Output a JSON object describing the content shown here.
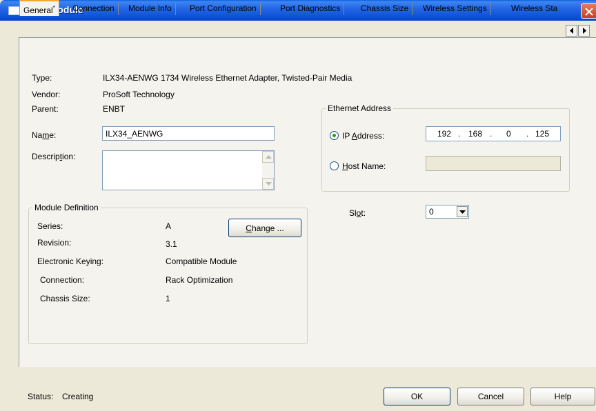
{
  "window": {
    "title": "New Module"
  },
  "tabs": [
    {
      "label": "General",
      "active": true,
      "mark": "*"
    },
    {
      "label": "Connection"
    },
    {
      "label": "Module Info"
    },
    {
      "label": "Port Configuration"
    },
    {
      "label": "Port Diagnostics"
    },
    {
      "label": "Chassis Size"
    },
    {
      "label": "Wireless Settings"
    },
    {
      "label": "Wireless Sta"
    }
  ],
  "general": {
    "type_label": "Type:",
    "type_value": "ILX34-AENWG 1734 Wireless Ethernet Adapter, Twisted-Pair Media",
    "vendor_label": "Vendor:",
    "vendor_value": "ProSoft Technology",
    "parent_label": "Parent:",
    "parent_value": "ENBT",
    "name_label_pre": "Na",
    "name_label_u": "m",
    "name_label_post": "e:",
    "name_value": "ILX34_AENWG",
    "desc_label_pre": "Descrip",
    "desc_label_u": "t",
    "desc_label_post": "ion:",
    "desc_value": ""
  },
  "module_definition": {
    "legend": "Module Definition",
    "series_label": "Series:",
    "series_value": "A",
    "revision_label": "Revision:",
    "revision_value": "3.1",
    "keying_label": "Electronic Keying:",
    "keying_value": "Compatible Module",
    "connection_label": "Connection:",
    "connection_value": "Rack Optimization",
    "chassis_label": "Chassis Size:",
    "chassis_value": "1",
    "change_pre": "",
    "change_u": "C",
    "change_post": "hange ..."
  },
  "ethernet": {
    "legend": "Ethernet Address",
    "ip_label_pre": "IP ",
    "ip_label_u": "A",
    "ip_label_post": "ddress:",
    "ip_octets": [
      "192",
      "168",
      "0",
      "125"
    ],
    "ip_dot": ".",
    "host_label_pre": "",
    "host_label_u": "H",
    "host_label_post": "ost Name:",
    "host_value": "",
    "selected": "ip"
  },
  "slot": {
    "label_pre": "Sl",
    "label_u": "o",
    "label_post": "t:",
    "value": "0"
  },
  "footer": {
    "status_label": "Status:",
    "status_value": "Creating",
    "ok": "OK",
    "cancel": "Cancel",
    "help": "Help"
  },
  "icons": {
    "close": "close-icon",
    "tab_left": "arrow-left-icon",
    "tab_right": "arrow-right-icon",
    "dropdown": "chevron-down-icon"
  },
  "colors": {
    "titlebar": "#2467e6",
    "dialog_bg": "#ece9d8",
    "panel_bg": "#f4f3ee",
    "close_red": "#c8411d"
  }
}
